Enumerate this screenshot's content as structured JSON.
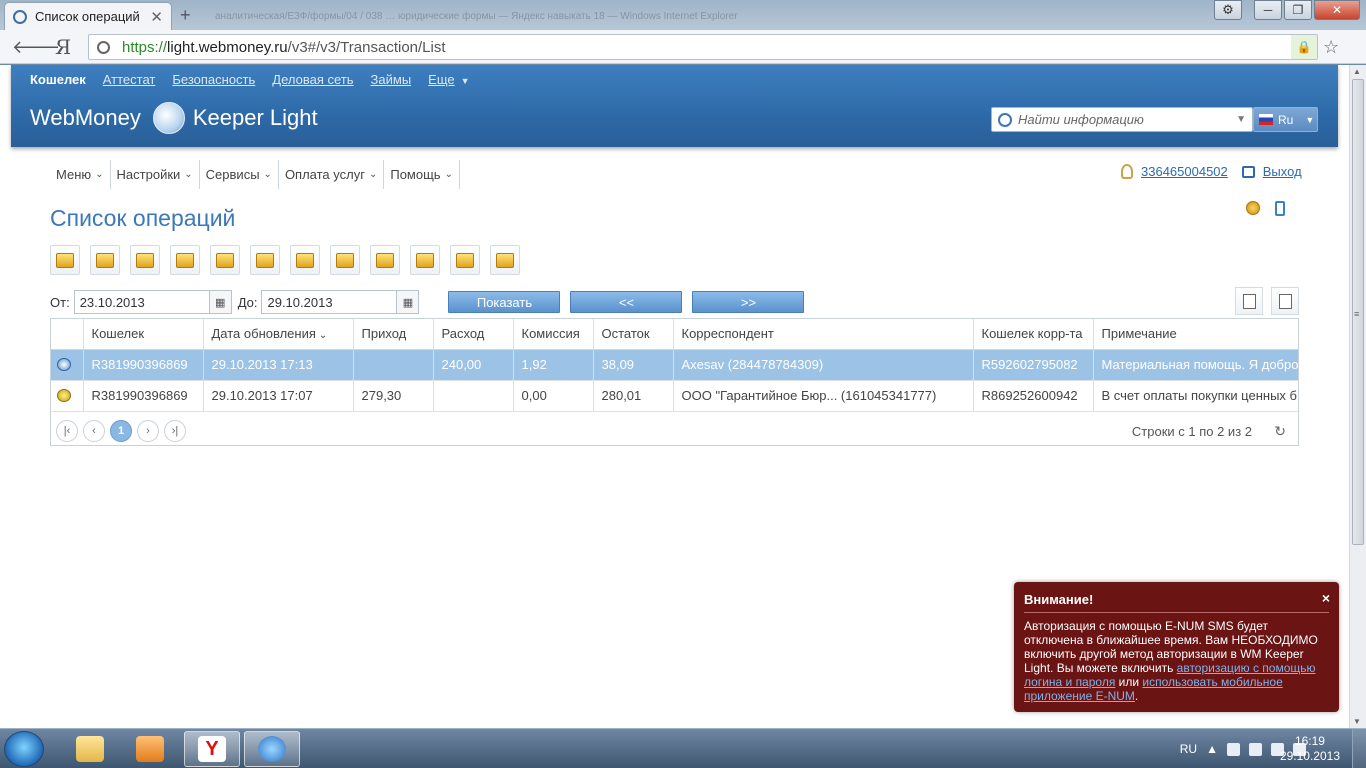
{
  "browser": {
    "tab_title": "Список операций",
    "bg_title": "аналитическая/ЕЗФ/формы/04 / 038 … юридические формы — Яндекс навыкать 18 — Windows Internet Explorer",
    "url_scheme": "https://",
    "url_host": "light.webmoney.ru",
    "url_path": "/v3#/v3/Transaction/List",
    "ya_label": "Я"
  },
  "header": {
    "nav": [
      "Кошелек",
      "Аттестат",
      "Безопасность",
      "Деловая сеть",
      "Займы",
      "Еще"
    ],
    "brand_left": "WebMoney",
    "brand_right": "Keeper Light",
    "search_placeholder": "Найти информацию",
    "lang": "Ru"
  },
  "menu": [
    "Меню",
    "Настройки",
    "Сервисы",
    "Оплата услуг",
    "Помощь"
  ],
  "user": {
    "wmid": "336465004502",
    "logout": "Выход"
  },
  "page_title": "Список операций",
  "filters": {
    "from_label": "От:",
    "from_value": "23.10.2013",
    "to_label": "До:",
    "to_value": "29.10.2013",
    "show_label": "Показать",
    "prev_label": "<<",
    "next_label": ">>"
  },
  "table": {
    "columns": [
      "",
      "Кошелек",
      "Дата обновления",
      "Приход",
      "Расход",
      "Комиссия",
      "Остаток",
      "Корреспондент",
      "Кошелек корр-та",
      "Примечание"
    ],
    "rows": [
      {
        "wallet": "R381990396869",
        "date": "29.10.2013 17:13",
        "income": "",
        "expense": "240,00",
        "fee": "1,92",
        "balance": "38,09",
        "correspondent": "Axesav (284478784309)",
        "corr_wallet": "R592602795082",
        "note": "Материальная помощь. Я добро",
        "selected": true
      },
      {
        "wallet": "R381990396869",
        "date": "29.10.2013 17:07",
        "income": "279,30",
        "expense": "",
        "fee": "0,00",
        "balance": "280,01",
        "correspondent": "ООО \"Гарантийное Бюр... (161045341777)",
        "corr_wallet": "R869252600942",
        "note": "В счет оплаты покупки ценных б",
        "selected": false
      }
    ],
    "pager": {
      "current_page": "1",
      "info": "Строки с 1 по 2 из 2"
    }
  },
  "notice": {
    "title": "Внимание!",
    "text1": "Авторизация с помощью E-NUM SMS будет отключена в ближайшее время. Вам НЕОБХОДИМО включить другой метод авторизации в WM Keeper Light. Вы можете включить ",
    "link1": "авторизацию с помощью логина и пароля",
    "text2": " или ",
    "link2": "использовать мобильное приложение E-NUM",
    "text3": ".",
    "close": "×"
  },
  "taskbar": {
    "lang": "RU",
    "time": "16:19",
    "date": "29.10.2013"
  }
}
